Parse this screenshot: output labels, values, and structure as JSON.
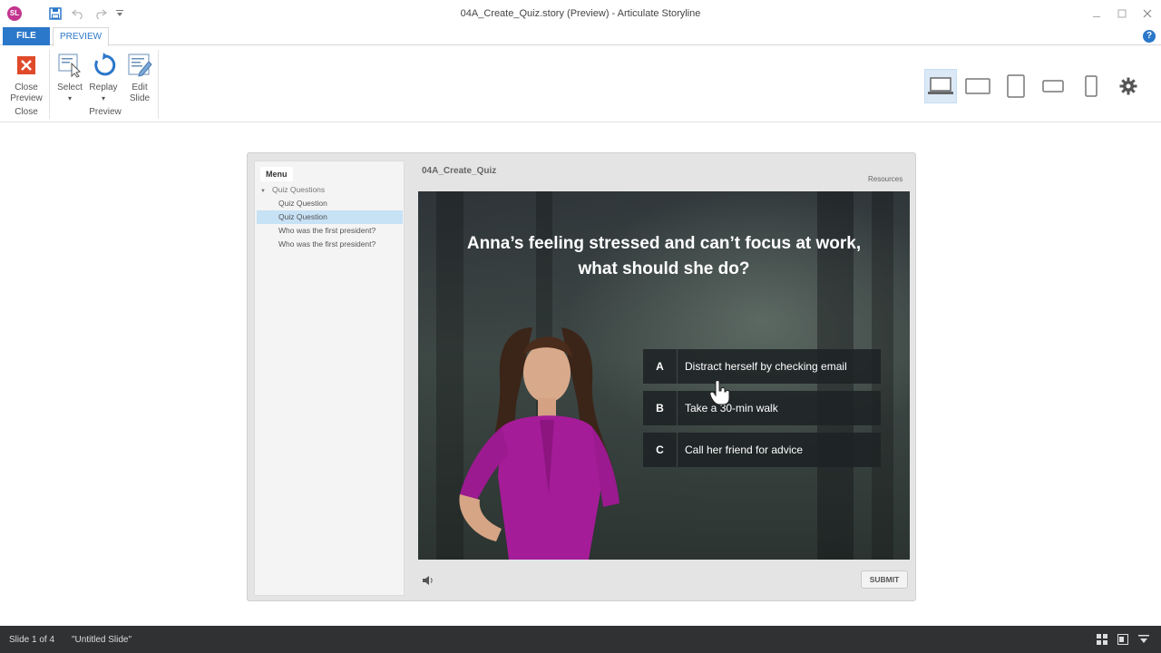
{
  "window": {
    "title": "04A_Create_Quiz.story (Preview) - Articulate Storyline",
    "logo_text": "SL"
  },
  "ribbon_tabs": {
    "file": "FILE",
    "preview": "PREVIEW",
    "help": "?"
  },
  "ribbon": {
    "close_preview": "Close Preview",
    "close_group": "Close",
    "select": "Select",
    "replay": "Replay",
    "edit_slide": "Edit Slide",
    "preview_group": "Preview"
  },
  "player": {
    "menu_tab": "Menu",
    "menu_items": [
      {
        "label": "Quiz Questions",
        "kind": "group"
      },
      {
        "label": "Quiz Question",
        "kind": "child"
      },
      {
        "label": "Quiz Question",
        "kind": "child",
        "selected": true
      },
      {
        "label": "Who was the first president?",
        "kind": "child"
      },
      {
        "label": "Who was the first president?",
        "kind": "child"
      }
    ],
    "slide_title": "04A_Create_Quiz",
    "resources": "Resources",
    "question": "Anna’s feeling stressed and can’t focus at work, what should she do?",
    "answers": [
      {
        "letter": "A",
        "text": "Distract herself by checking email"
      },
      {
        "letter": "B",
        "text": "Take a 30-min walk"
      },
      {
        "letter": "C",
        "text": "Call her friend for advice"
      }
    ],
    "submit": "SUBMIT"
  },
  "status": {
    "slide": "Slide 1 of 4",
    "name": "\"Untitled Slide\""
  },
  "colors": {
    "accent": "#2b77c9",
    "selected_menu": "#c7e1f5",
    "status_bar": "#2f3133",
    "close_red": "#e04a2a"
  }
}
